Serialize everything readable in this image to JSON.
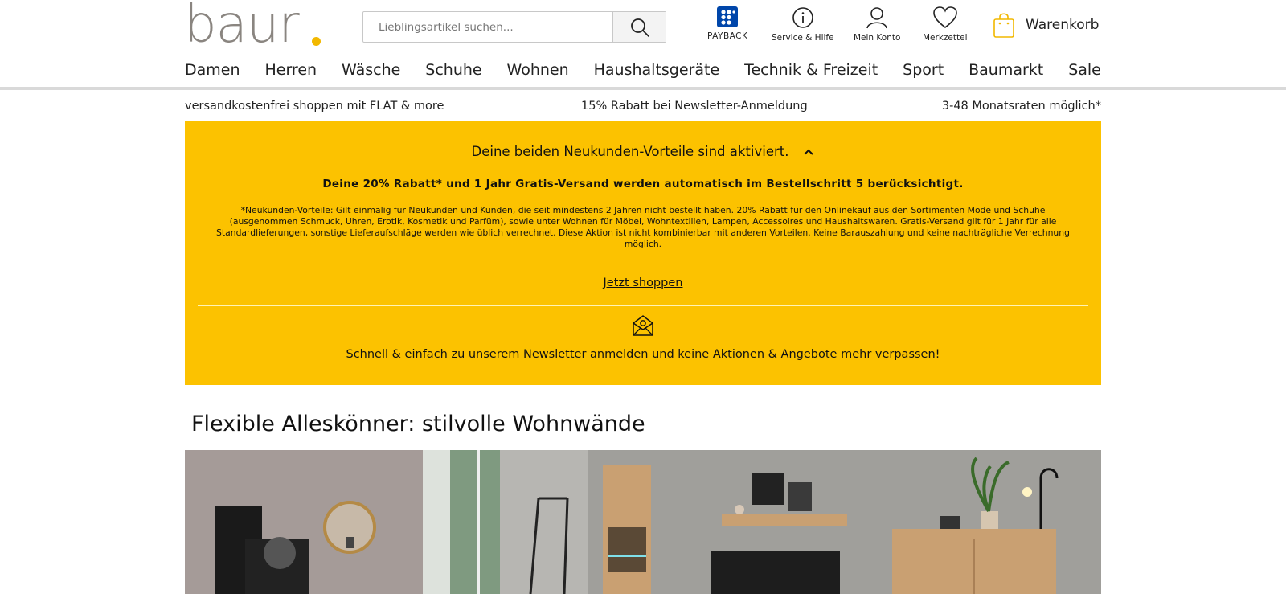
{
  "brand": {
    "logo_text": "baur"
  },
  "search": {
    "placeholder": "Lieblingsartikel suchen..."
  },
  "header_icons": {
    "payback": "PAYBACK",
    "service": "Service & Hilfe",
    "account": "Mein Konto",
    "wishlist": "Merkzettel",
    "cart": "Warenkorb"
  },
  "nav": {
    "items": [
      "Damen",
      "Herren",
      "Wäsche",
      "Schuhe",
      "Wohnen",
      "Haushaltsgeräte",
      "Technik & Freizeit",
      "Sport",
      "Baumarkt",
      "Sale"
    ]
  },
  "usp": {
    "left": "versandkostenfrei shoppen mit FLAT & more",
    "center": "15% Rabatt bei Newsletter-Anmeldung",
    "right": "3-48 Monatsraten möglich*"
  },
  "promo": {
    "headline": "Deine beiden Neukunden-Vorteile sind aktiviert.",
    "bold": "Deine 20% Rabatt* und 1 Jahr Gratis-Versand werden automatisch im Bestellschritt 5 berücksichtigt.",
    "small": "*Neukunden-Vorteile: Gilt einmalig für Neukunden und Kunden, die seit mindestens 2 Jahren nicht bestellt haben. 20% Rabatt für den Onlinekauf aus den Sortimenten Mode und Schuhe (ausgenommen Schmuck, Uhren, Erotik, Kosmetik und Parfüm), sowie unter Wohnen für Möbel, Wohntextilien, Lampen, Accessoires und Haushaltswaren. Gratis-Versand gilt für 1 Jahr für alle Standardlieferungen, sonstige Lieferaufschläge werden wie üblich verrechnet. Diese Aktion ist nicht kombinierbar mit anderen Vorteilen. Keine Barauszahlung und keine nachträgliche Verrechnung möglich.",
    "link": "Jetzt shoppen",
    "newsletter": "Schnell & einfach zu unserem Newsletter anmelden und keine Aktionen & Angebote mehr verpassen!"
  },
  "section": {
    "title": "Flexible Alleskönner: stilvolle Wohnwände"
  },
  "colors": {
    "accent": "#fcc200",
    "logo_gray": "#8a8580",
    "logo_dot": "#f2b800",
    "payback_blue": "#0046aa"
  }
}
